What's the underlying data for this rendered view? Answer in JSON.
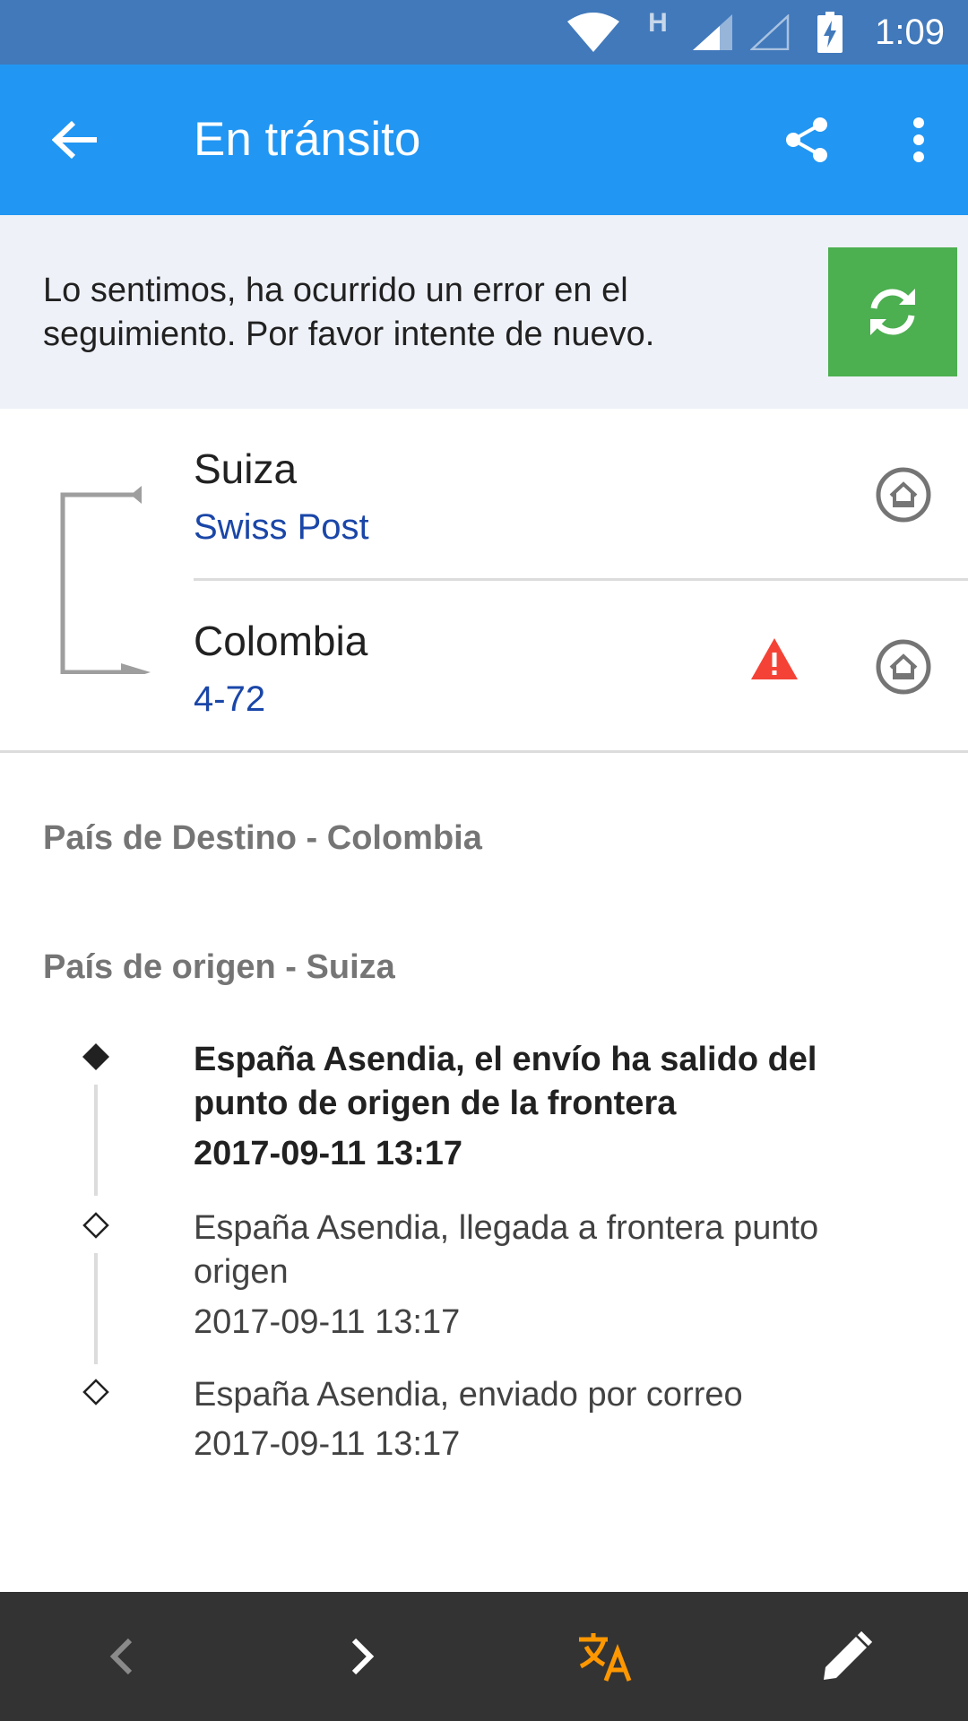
{
  "status_bar": {
    "time": "1:09",
    "network_type": "H",
    "icons": [
      "wifi-icon",
      "signal-icon",
      "signal-empty-icon",
      "battery-charging-icon"
    ]
  },
  "app_bar": {
    "title": "En tránsito",
    "icons": {
      "back": "arrow-back-icon",
      "share": "share-icon",
      "more": "more-vert-icon"
    },
    "color": "#2196f3"
  },
  "error": {
    "message": "Lo sentimos, ha ocurrido un error en el seguimiento. Por favor intente de nuevo.",
    "retry_icon": "refresh-icon",
    "retry_color": "#4caf50"
  },
  "route": {
    "origin": {
      "country": "Suiza",
      "carrier": "Swiss Post"
    },
    "destination": {
      "country": "Colombia",
      "carrier": "4-72",
      "warning": true
    }
  },
  "sections": {
    "destination_header": "País de Destino - Colombia",
    "origin_header": "País de origen - Suiza"
  },
  "events": [
    {
      "text": "España Asendia, el envío ha salido del punto de origen de la frontera",
      "time": "2017-09-11 13:17",
      "current": true
    },
    {
      "text": "España Asendia, llegada a frontera punto origen",
      "time": "2017-09-11 13:17",
      "current": false
    },
    {
      "text": "España Asendia, enviado por correo",
      "time": "2017-09-11 13:17",
      "current": false
    }
  ],
  "bottom_bar": {
    "buttons": [
      "chevron-left-icon",
      "chevron-right-icon",
      "translate-icon",
      "edit-icon"
    ],
    "translate_color": "#ff9800"
  }
}
